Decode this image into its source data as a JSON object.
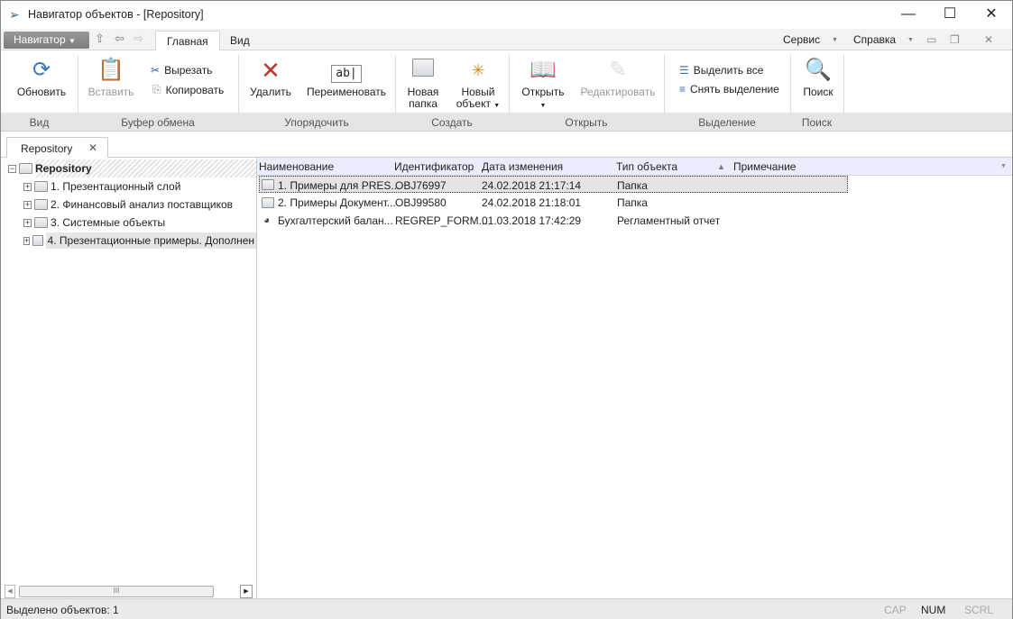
{
  "window": {
    "title": "Навигатор объектов - [Repository]",
    "minimize": "—",
    "maximize": "☐",
    "close": "✕"
  },
  "menu": {
    "navigator": "Навигатор",
    "tabs": [
      "Главная",
      "Вид"
    ],
    "service": "Сервис",
    "help": "Справка"
  },
  "ribbon": {
    "refresh": "Обновить",
    "paste": "Вставить",
    "cut": "Вырезать",
    "copy": "Копировать",
    "delete": "Удалить",
    "rename": "Переименовать",
    "new_folder": [
      "Новая",
      "папка"
    ],
    "new_object": [
      "Новый",
      "объект"
    ],
    "open": "Открыть",
    "edit": "Редактировать",
    "select_all": "Выделить все",
    "deselect": "Снять выделение",
    "search": "Поиск",
    "groups": [
      "Вид",
      "Буфер обмена",
      "Упорядочить",
      "Создать",
      "Открыть",
      "Выделение",
      "Поиск"
    ]
  },
  "doc_tab": {
    "label": "Repository"
  },
  "tree": {
    "root": "Repository",
    "items": [
      "1. Презентационный слой",
      "2. Финансовый анализ поставщиков",
      "3. Системные объекты",
      "4. Презентационные примеры. Дополнен"
    ]
  },
  "list": {
    "columns": [
      "Наименование",
      "Идентификатор",
      "Дата изменения",
      "Тип объекта",
      "Примечание"
    ],
    "rows": [
      {
        "name": "1. Примеры для PRES...",
        "id": "OBJ76997",
        "date": "24.02.2018 21:17:14",
        "type": "Папка",
        "icon": "folder"
      },
      {
        "name": "2. Примеры Документ...",
        "id": "OBJ99580",
        "date": "24.02.2018 21:18:01",
        "type": "Папка",
        "icon": "folder"
      },
      {
        "name": "Бухгалтерский балан...",
        "id": "REGREP_FORM...",
        "date": "01.03.2018 17:42:29",
        "type": "Регламентный отчет",
        "icon": "report"
      }
    ]
  },
  "status": {
    "text": "Выделено объектов: 1",
    "cap": "CAP",
    "num": "NUM",
    "scrl": "SCRL"
  }
}
